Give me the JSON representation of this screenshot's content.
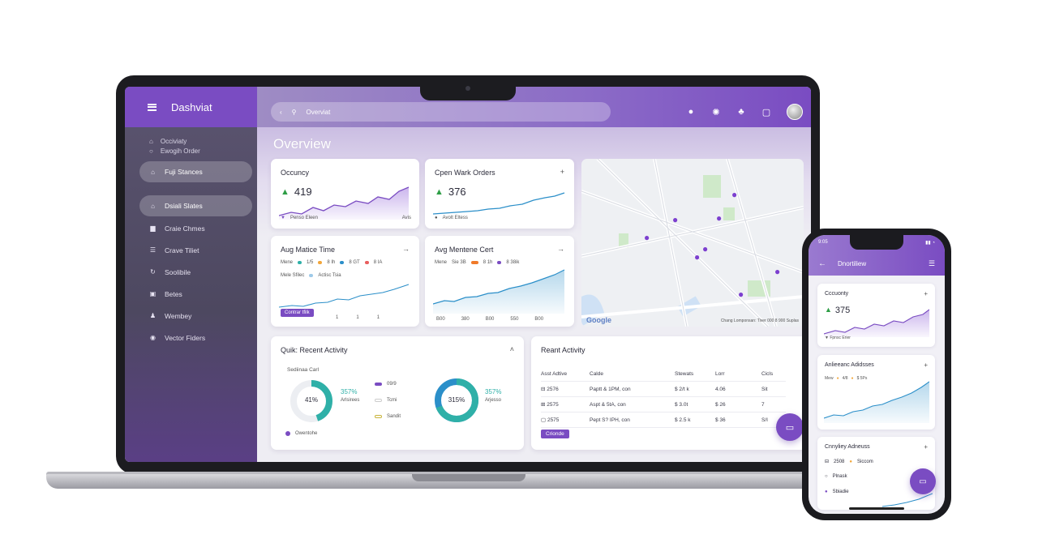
{
  "laptop": {
    "sidebar": {
      "brand": "Dashviat",
      "group": [
        "Occiviaty",
        "Ewogih Order"
      ],
      "items": [
        {
          "label": "Fuji Stances",
          "active": true
        },
        {
          "label": "Dsiali Slates",
          "active": true
        },
        {
          "label": "Craie Chmes"
        },
        {
          "label": "Crave Tiliet"
        },
        {
          "label": "Soolibile"
        },
        {
          "label": "Betes"
        },
        {
          "label": "Wembey"
        },
        {
          "label": "Vector Fiders"
        }
      ]
    },
    "search_value": "Overviat",
    "page_title": "Overview",
    "cards": {
      "occupancy": {
        "title": "Occuncy",
        "value": "419",
        "legend": "Penso Eleen",
        "tag": "Avis"
      },
      "work_orders": {
        "title": "Cpen Wark Orders",
        "value": "376",
        "legend": "Avolt Eltess"
      },
      "maint_time": {
        "title": "Aug Matice Time",
        "legend1": "Mene",
        "l1a": "1/5",
        "l1b": "8 Ih",
        "l1c": "8 GT",
        "l1d": "8 IA",
        "legend2": "Mele Sfilec",
        "legend2b": "Actisc Tsia",
        "badge": "Contrar tfilk",
        "ticks": [
          "",
          "1",
          "1",
          "",
          "1"
        ]
      },
      "maint_cost": {
        "title": "Avg Mentene Cert",
        "legend1": "Mene",
        "l1a": "Sie 3B",
        "l1b": "8 1h",
        "l1c": "8 38ik",
        "ticks": [
          "B00",
          "380",
          "B00",
          "550",
          "B00"
        ]
      }
    },
    "map": {
      "logo": "Google",
      "credit": "Chang Lomponsan: Tiver 000 8 900 Suplas"
    },
    "quick": {
      "title": "Quik: Recent Activity",
      "subtitle": "Sediinaa Carl",
      "donut1": {
        "center": "41%",
        "pct": "357%",
        "label": "Arlsirees"
      },
      "legend": [
        "09/9",
        "Tcmi",
        "Sandit"
      ],
      "donut2": {
        "center": "315%",
        "pct": "357%",
        "label": "Arjesso"
      },
      "footer": "Owentohe"
    },
    "activity": {
      "title": "Reant Activity",
      "headers": [
        "Asst Adtive",
        "Calde",
        "Stewats",
        "Lorr",
        "Cicls"
      ],
      "rows": [
        [
          "2576",
          "Paptt & 1PM, con",
          "$ 2/t k",
          "4.06",
          "Sit"
        ],
        [
          "2575",
          "Aspt & 5tA, con",
          "$ 3.0t",
          "$ 26",
          "7"
        ],
        [
          "2575",
          "Pept S? IPH, con",
          "$ 2.5 k",
          "$ 36",
          "S/I"
        ]
      ],
      "button": "Crionde"
    }
  },
  "phone": {
    "time": "9:05",
    "title": "Dnortiliew",
    "occupancy": {
      "title": "Cccuonty",
      "value": "375",
      "legend": "Fpnsc Erier"
    },
    "second": {
      "title": "Anlieeanc Adidsses",
      "legend": "Mew",
      "la": "4/8",
      "lb": "$ 5Ps"
    },
    "recent": {
      "title": "Cnnyliey Adneuss",
      "r1a": "2508",
      "r1b": "Siccom",
      "r2": "Plnask",
      "r3": "Sbiadie"
    }
  },
  "colors": {
    "accent": "#7a4cc2",
    "teal": "#2fb0a8",
    "green": "#2e9e46",
    "pin": "#7c3fcf"
  }
}
